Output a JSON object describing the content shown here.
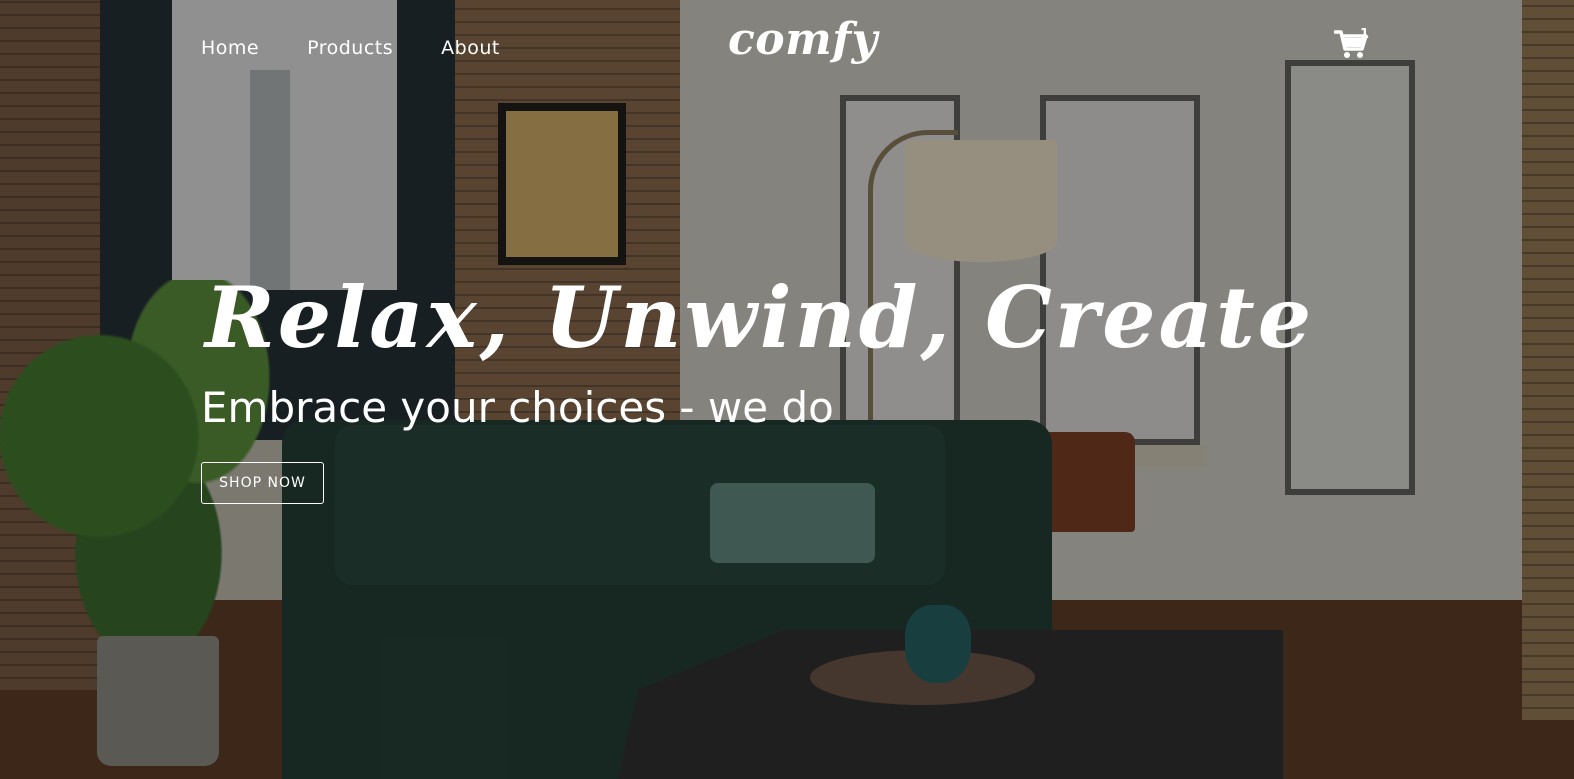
{
  "nav": {
    "links": [
      {
        "label": "Home"
      },
      {
        "label": "Products"
      },
      {
        "label": "About"
      }
    ],
    "logo": "comfy",
    "cart": {
      "icon": "cart-icon",
      "count": "1"
    }
  },
  "hero": {
    "title": "Relax, Unwind, Create",
    "subtitle": "Embrace your choices - we do",
    "cta_label": "SHOP NOW"
  },
  "colors": {
    "text": "#ffffff",
    "overlay": "rgba(20, 16, 12, 0.42)"
  }
}
